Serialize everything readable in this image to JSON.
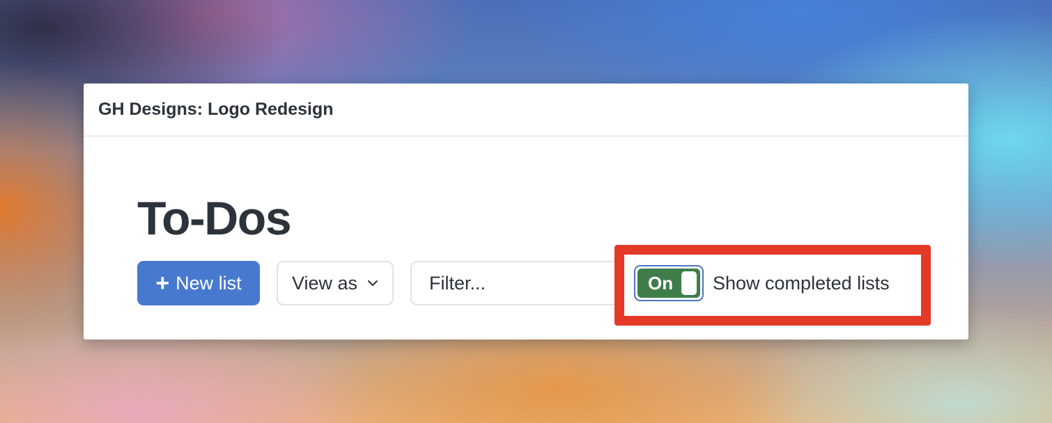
{
  "window": {
    "title": "GH Designs: Logo Redesign"
  },
  "page": {
    "heading": "To-Dos"
  },
  "toolbar": {
    "new_list": {
      "icon": "plus-icon",
      "icon_glyph": "+",
      "label": "New list",
      "color": "#4779cf"
    },
    "view_as": {
      "label": "View as",
      "icon": "chevron-down-icon"
    },
    "filter": {
      "placeholder": "Filter...",
      "value": ""
    },
    "show_completed": {
      "state": "On",
      "checked": true,
      "label": "Show completed lists",
      "track_color": "#3f7d4a"
    }
  },
  "annotation": {
    "highlight_color": "#e23a27"
  }
}
